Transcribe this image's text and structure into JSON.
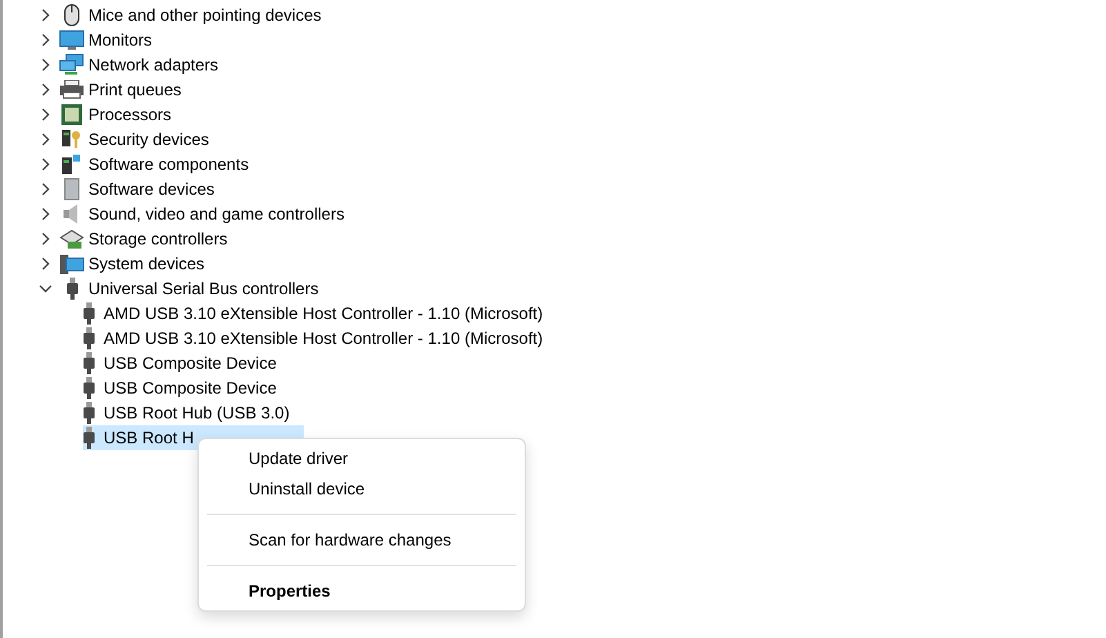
{
  "tree": [
    {
      "label": "Mice and other pointing devices",
      "expanded": false
    },
    {
      "label": "Monitors",
      "expanded": false
    },
    {
      "label": "Network adapters",
      "expanded": false
    },
    {
      "label": "Print queues",
      "expanded": false
    },
    {
      "label": "Processors",
      "expanded": false
    },
    {
      "label": "Security devices",
      "expanded": false
    },
    {
      "label": "Software components",
      "expanded": false
    },
    {
      "label": "Software devices",
      "expanded": false
    },
    {
      "label": "Sound, video and game controllers",
      "expanded": false
    },
    {
      "label": "Storage controllers",
      "expanded": false
    },
    {
      "label": "System devices",
      "expanded": false
    },
    {
      "label": "Universal Serial Bus controllers",
      "expanded": true,
      "children": [
        {
          "label": "AMD USB 3.10 eXtensible Host Controller - 1.10 (Microsoft)",
          "selected": false
        },
        {
          "label": "AMD USB 3.10 eXtensible Host Controller - 1.10 (Microsoft)",
          "selected": false
        },
        {
          "label": "USB Composite Device",
          "selected": false
        },
        {
          "label": "USB Composite Device",
          "selected": false
        },
        {
          "label": "USB Root Hub (USB 3.0)",
          "selected": false
        },
        {
          "label": "USB Root H",
          "selected": true
        }
      ]
    }
  ],
  "context_menu": [
    {
      "kind": "item",
      "label": "Update driver"
    },
    {
      "kind": "item",
      "label": "Uninstall device"
    },
    {
      "kind": "separator"
    },
    {
      "kind": "item",
      "label": "Scan for hardware changes"
    },
    {
      "kind": "separator"
    },
    {
      "kind": "default",
      "label": "Properties"
    }
  ]
}
